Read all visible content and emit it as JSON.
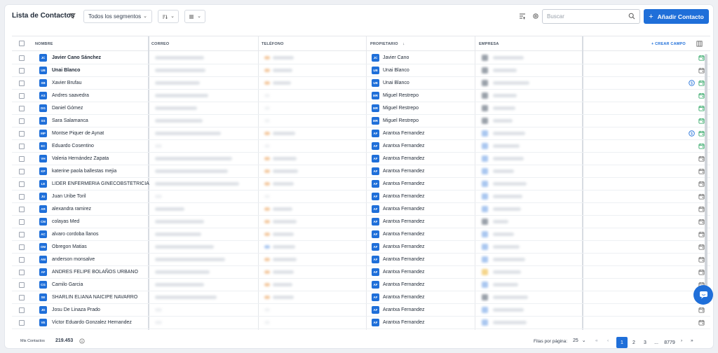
{
  "header": {
    "title": "Lista de Contactos",
    "segment_select": "Todos los segmentos",
    "search_placeholder": "Buscar",
    "add_button": "Añadir Contacto",
    "add_button_icon": "plus-icon"
  },
  "table": {
    "columns": [
      "NOMBRE",
      "CORREO",
      "TELÉFONO",
      "PROPIETARIO",
      "EMPRESA"
    ],
    "create_field": "+ CREAR CAMPO",
    "rows": [
      {
        "initials": "JC",
        "name": "Javier Cano Sánchez",
        "owner_initials": "JC",
        "owner": "Javier Cano",
        "email": true,
        "phone": "orange",
        "company": "gray",
        "coin": false,
        "cal": "green"
      },
      {
        "initials": "UB",
        "name": "Unai Blanco",
        "owner_initials": "UB",
        "owner": "Unai Blanco",
        "email": true,
        "phone": "orange",
        "company": "gray",
        "coin": false,
        "cal": "gray"
      },
      {
        "initials": "XB",
        "name": "Xavier Brufau",
        "owner_initials": "UB",
        "owner": "Unai Blanco",
        "email": true,
        "phone": "orange",
        "company": "gray",
        "coin": true,
        "cal": "green"
      },
      {
        "initials": "AS",
        "name": "Andres saavedra",
        "owner_initials": "MR",
        "owner": "Miguel Restrepo",
        "email": true,
        "phone": "",
        "company": "gray",
        "coin": false,
        "cal": "green"
      },
      {
        "initials": "DG",
        "name": "Daniel Gómez",
        "owner_initials": "MR",
        "owner": "Miguel Restrepo",
        "email": true,
        "phone": "",
        "company": "gray",
        "coin": false,
        "cal": "green"
      },
      {
        "initials": "SS",
        "name": "Sara Salamanca",
        "owner_initials": "MR",
        "owner": "Miguel Restrepo",
        "email": true,
        "phone": "",
        "company": "gray",
        "coin": false,
        "cal": "green"
      },
      {
        "initials": "MP",
        "name": "Montse Piquer de Aynat",
        "owner_initials": "AF",
        "owner": "Arantxa Fernandez",
        "email": true,
        "phone": "orange",
        "company": "blue",
        "coin": true,
        "cal": "green"
      },
      {
        "initials": "EC",
        "name": "Eduardo Cosentino",
        "owner_initials": "AF",
        "owner": "Arantxa Fernandez",
        "email": false,
        "phone": "",
        "company": "blue",
        "coin": false,
        "cal": "green"
      },
      {
        "initials": "VH",
        "name": "Valeria Hernández Zapata",
        "owner_initials": "AF",
        "owner": "Arantxa Fernandez",
        "email": true,
        "phone": "orange",
        "company": "blue",
        "coin": false,
        "cal": "gray"
      },
      {
        "initials": "KP",
        "name": "katerine paola ballestas mejia",
        "owner_initials": "AF",
        "owner": "Arantxa Fernandez",
        "email": true,
        "phone": "orange",
        "company": "blue",
        "coin": false,
        "cal": "gray"
      },
      {
        "initials": "LE",
        "name": "LIDER ENFERMERIA GINECOBSTETRICIA",
        "owner_initials": "AF",
        "owner": "Arantxa Fernandez",
        "email": true,
        "phone": "orange",
        "company": "blue",
        "coin": false,
        "cal": "gray"
      },
      {
        "initials": "JU",
        "name": "Juan Uribe Toril",
        "owner_initials": "AF",
        "owner": "Arantxa Fernandez",
        "email": false,
        "phone": "",
        "company": "blue",
        "coin": false,
        "cal": "gray"
      },
      {
        "initials": "AR",
        "name": "alexandra ramirez",
        "owner_initials": "AF",
        "owner": "Arantxa Fernandez",
        "email": true,
        "phone": "orange",
        "company": "blue",
        "coin": false,
        "cal": "gray"
      },
      {
        "initials": "CM",
        "name": "colayas Med",
        "owner_initials": "AF",
        "owner": "Arantxa Fernandez",
        "email": true,
        "phone": "orange",
        "company": "gray",
        "coin": false,
        "cal": "gray"
      },
      {
        "initials": "AC",
        "name": "alvaro cordoba llanos",
        "owner_initials": "AF",
        "owner": "Arantxa Fernandez",
        "email": true,
        "phone": "orange",
        "company": "blue",
        "coin": false,
        "cal": "gray"
      },
      {
        "initials": "OM",
        "name": "Obregon Matias",
        "owner_initials": "AF",
        "owner": "Arantxa Fernandez",
        "email": true,
        "phone": "blue",
        "company": "blue",
        "coin": false,
        "cal": "gray"
      },
      {
        "initials": "AM",
        "name": "anderson monsalve",
        "owner_initials": "AF",
        "owner": "Arantxa Fernandez",
        "email": true,
        "phone": "orange",
        "company": "blue",
        "coin": false,
        "cal": "gray"
      },
      {
        "initials": "AF",
        "name": "ANDRES FELIPE BOLAÑOS URBANO",
        "owner_initials": "AF",
        "owner": "Arantxa Fernandez",
        "email": true,
        "phone": "orange",
        "company": "yellow",
        "coin": false,
        "cal": "gray"
      },
      {
        "initials": "CG",
        "name": "Camilo Garcia",
        "owner_initials": "AF",
        "owner": "Arantxa Fernandez",
        "email": true,
        "phone": "orange",
        "company": "blue",
        "coin": false,
        "cal": "gray"
      },
      {
        "initials": "SE",
        "name": "SHARLIN ELIANA NAICIPE NAVARRO",
        "owner_initials": "AF",
        "owner": "Arantxa Fernandez",
        "email": true,
        "phone": "orange",
        "company": "gray",
        "coin": false,
        "cal": "gray"
      },
      {
        "initials": "JD",
        "name": "Josu De Linaza Prado",
        "owner_initials": "AF",
        "owner": "Arantxa Fernandez",
        "email": false,
        "phone": "",
        "company": "blue",
        "coin": false,
        "cal": "gray"
      },
      {
        "initials": "VE",
        "name": "Victor Eduardo Gonzalez Hernandez",
        "owner_initials": "AF",
        "owner": "Arantxa Fernandez",
        "email": false,
        "phone": "",
        "company": "blue",
        "coin": false,
        "cal": "gray"
      }
    ]
  },
  "footer": {
    "label": "Mis Contactos",
    "count": "219.453",
    "per_page_label": "Filas por página:",
    "per_page_value": "25",
    "pages": [
      "1",
      "2",
      "3",
      "...",
      "8779"
    ]
  },
  "colors": {
    "accent": "#1f6fd9",
    "green": "#22a05b"
  }
}
